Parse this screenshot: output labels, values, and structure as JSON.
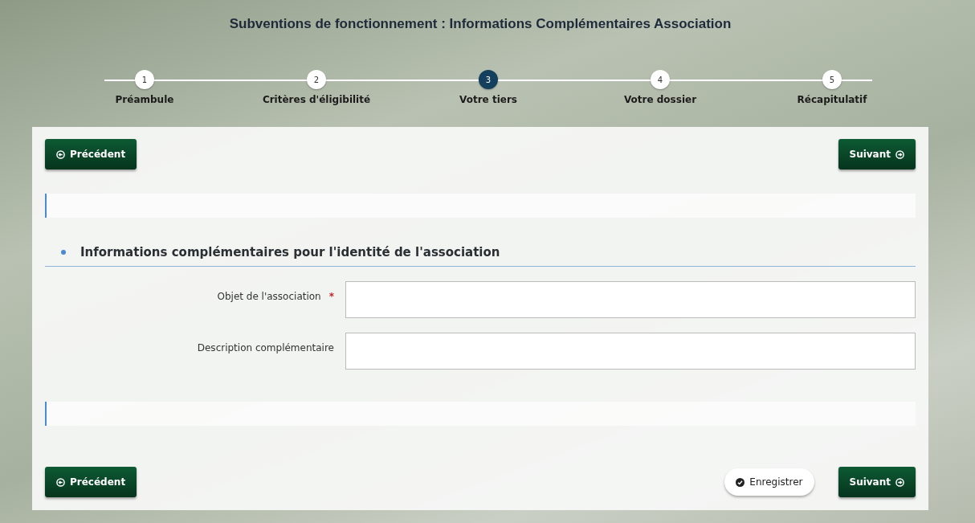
{
  "title": "Subventions de fonctionnement : Informations Complémentaires Association",
  "steps": [
    {
      "number": "1",
      "label": "Préambule",
      "selected": false
    },
    {
      "number": "2",
      "label": "Critères d'éligibilité",
      "selected": false
    },
    {
      "number": "3",
      "label": "Votre tiers",
      "selected": true
    },
    {
      "number": "4",
      "label": "Votre dossier",
      "selected": false
    },
    {
      "number": "5",
      "label": "Récapitulatif",
      "selected": false
    }
  ],
  "top_nav": {
    "previous": "Précédent",
    "next": "Suivant"
  },
  "section": {
    "heading": "Informations complémentaires pour l'identité de l'association",
    "fields": [
      {
        "label": "Objet de l'association",
        "required": true,
        "required_mark": "*"
      },
      {
        "label": "Description complémentaire",
        "required": false
      }
    ]
  },
  "bottom_nav": {
    "previous": "Précédent",
    "save": "Enregistrer",
    "next": "Suivant"
  }
}
